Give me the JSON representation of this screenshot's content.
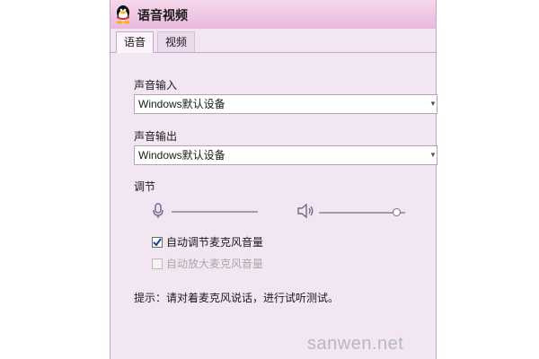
{
  "window": {
    "title": "语音视频"
  },
  "tabs": [
    {
      "label": "语音",
      "active": true
    },
    {
      "label": "视频",
      "active": false
    }
  ],
  "input": {
    "label": "声音输入",
    "selected": "Windows默认设备"
  },
  "output": {
    "label": "声音输出",
    "selected": "Windows默认设备"
  },
  "adjust": {
    "label": "调节",
    "mic_icon": "microphone-icon",
    "speaker_icon": "speaker-icon",
    "mic_level": 0.0,
    "speaker_level": 0.9
  },
  "options": [
    {
      "label": "自动调节麦克风音量",
      "checked": true,
      "enabled": true
    },
    {
      "label": "自动放大麦克风音量",
      "checked": false,
      "enabled": false
    }
  ],
  "hint": "提示：请对着麦克风说话，进行试听测试。",
  "watermark": "sanwen.net"
}
